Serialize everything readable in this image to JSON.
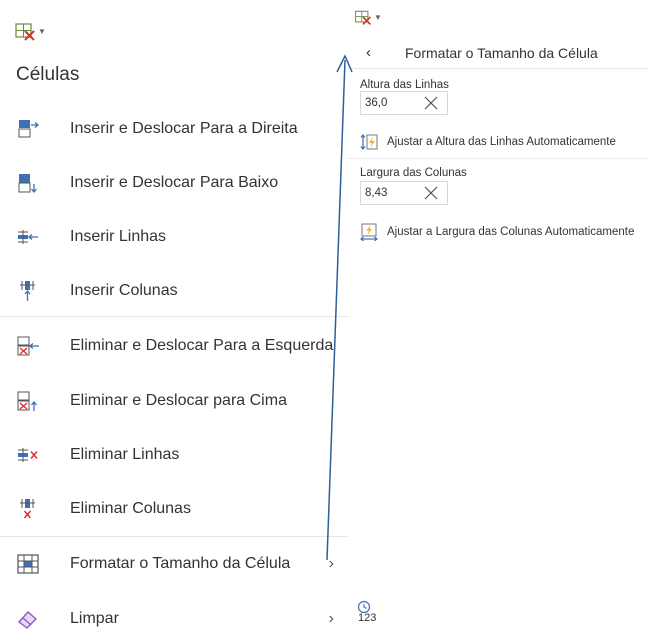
{
  "left_panel": {
    "title": "Células",
    "items": [
      {
        "label": "Inserir e Deslocar Para a Direita",
        "icon": "insert-shift-right-icon"
      },
      {
        "label": "Inserir e Deslocar Para Baixo",
        "icon": "insert-shift-down-icon"
      },
      {
        "label": "Inserir Linhas",
        "icon": "insert-rows-icon"
      },
      {
        "label": "Inserir Colunas",
        "icon": "insert-columns-icon"
      },
      {
        "label": "Eliminar e Deslocar Para a Esquerda",
        "icon": "delete-shift-left-icon"
      },
      {
        "label": "Eliminar e Deslocar para Cima",
        "icon": "delete-shift-up-icon"
      },
      {
        "label": "Eliminar Linhas",
        "icon": "delete-rows-icon"
      },
      {
        "label": "Eliminar Colunas",
        "icon": "delete-columns-icon"
      },
      {
        "label": "Formatar o Tamanho da Célula",
        "icon": "format-cell-size-icon",
        "chevron": "›"
      },
      {
        "label": "Limpar",
        "icon": "eraser-icon",
        "chevron": "›"
      }
    ]
  },
  "right_panel": {
    "back_symbol": "‹",
    "title": "Formatar o Tamanho da Célula",
    "row_height": {
      "label": "Altura das Linhas",
      "value": "36,0"
    },
    "auto_row_height": "Ajustar a Altura das Linhas Automaticamente",
    "column_width": {
      "label": "Largura das Colunas",
      "value": "8,43"
    },
    "auto_column_width": "Ajustar a Largura das Colunas Automaticamente",
    "bottom_icon_text": "123"
  },
  "colors": {
    "accent_red": "#d9342b",
    "icon_blue": "#3f6fb5",
    "arrow": "#2f5f99",
    "text": "#333333"
  }
}
